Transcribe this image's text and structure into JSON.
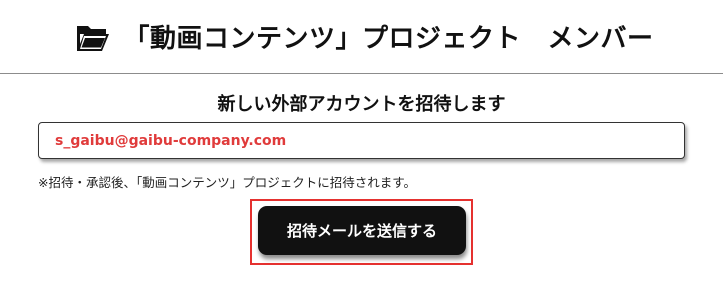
{
  "header": {
    "title": "「動画コンテンツ」プロジェクト　メンバー",
    "icon": "open-folder-icon"
  },
  "invite": {
    "heading": "新しい外部アカウントを招待します",
    "email_value": "s_gaibu@gaibu-company.com",
    "note": "※招待・承認後、「動画コンテンツ」プロジェクトに招待されます。",
    "send_label": "招待メールを送信する"
  },
  "colors": {
    "email_text": "#e03b3b",
    "highlight_border": "#e5312f",
    "button_bg": "#111111"
  }
}
